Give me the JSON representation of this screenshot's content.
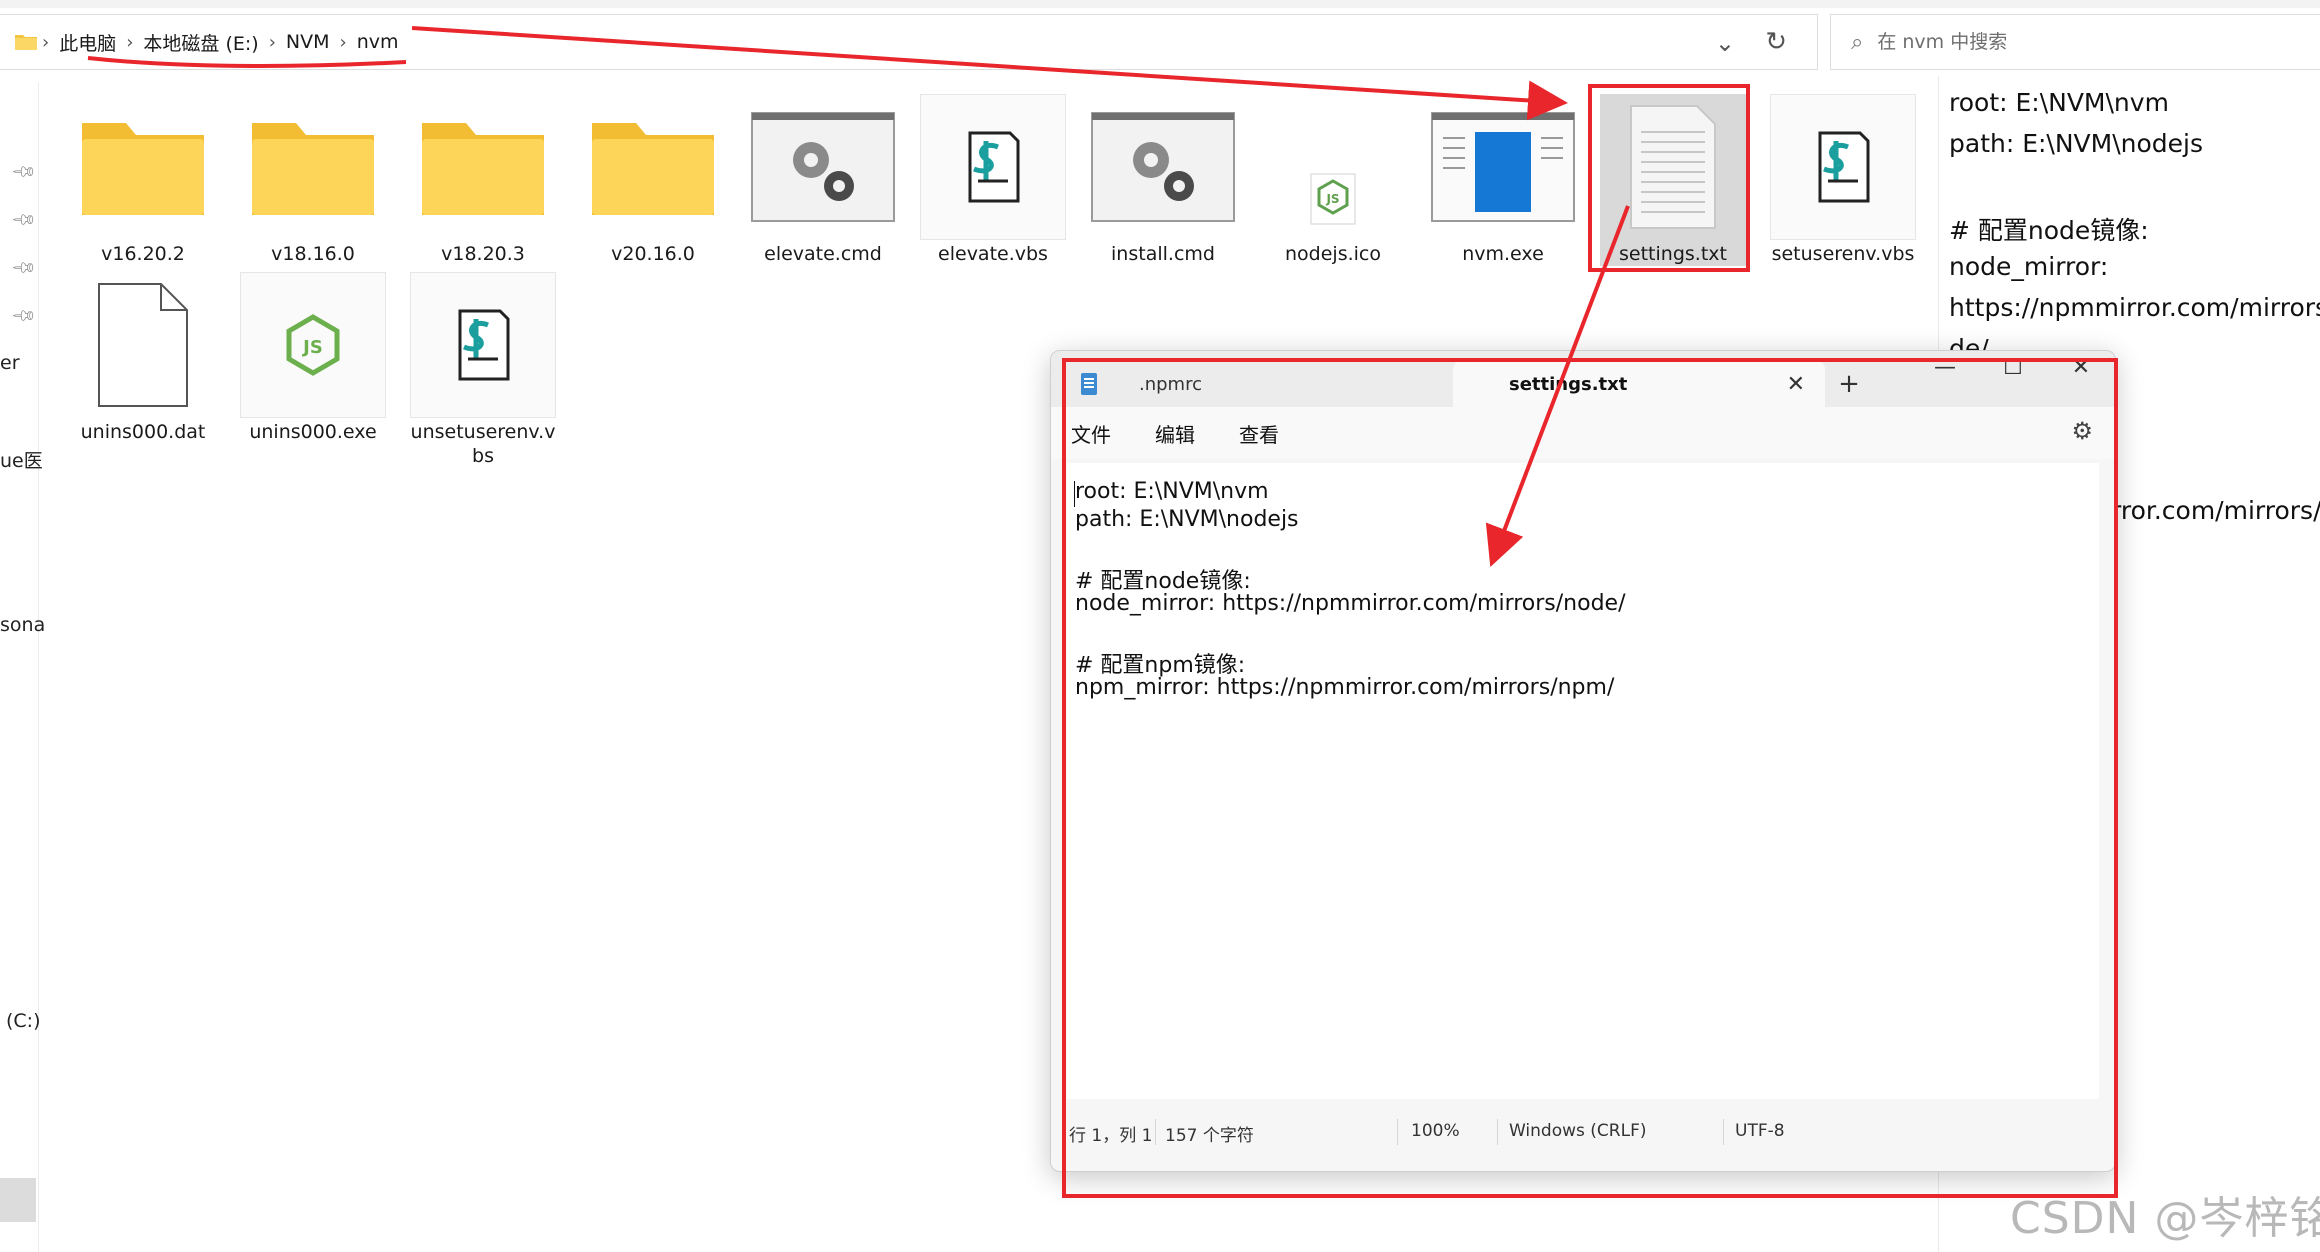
{
  "explorer": {
    "breadcrumbs": [
      "此电脑",
      "本地磁盘 (E:)",
      "NVM",
      "nvm"
    ],
    "search_placeholder": "在 nvm 中搜索",
    "nav_labels": [
      "er",
      "ue医",
      "sona",
      "(C:)"
    ],
    "files_row1": [
      {
        "name": "v16.20.2",
        "icon": "folder-icon"
      },
      {
        "name": "v18.16.0",
        "icon": "folder-icon"
      },
      {
        "name": "v18.20.3",
        "icon": "folder-icon"
      },
      {
        "name": "v20.16.0",
        "icon": "folder-icon"
      },
      {
        "name": "elevate.cmd",
        "icon": "cmd-gear-icon"
      },
      {
        "name": "elevate.vbs",
        "icon": "vbs-script-icon"
      },
      {
        "name": "install.cmd",
        "icon": "cmd-gear-icon"
      },
      {
        "name": "nodejs.ico",
        "icon": "nodejs-icon"
      },
      {
        "name": "nvm.exe",
        "icon": "exe-window-icon"
      },
      {
        "name": "settings.txt",
        "icon": "text-file-icon"
      },
      {
        "name": "setuserenv.vbs",
        "icon": "vbs-script-icon"
      }
    ],
    "files_row2": [
      {
        "name": "unins000.dat",
        "icon": "blank-file-icon"
      },
      {
        "name": "unins000.exe",
        "icon": "nodejs-icon"
      },
      {
        "name": "unsetuserenv.vbs",
        "icon": "vbs-script-icon"
      }
    ],
    "selected_file": "settings.txt"
  },
  "preview": {
    "lines": [
      "root: E:\\NVM\\nvm",
      "path: E:\\NVM\\nodejs",
      "# 配置node镜像:",
      "node_mirror:",
      "https://npmmirror.com/mirrors/n",
      "de/",
      ":",
      "rror.com/mirrors/n"
    ]
  },
  "notepad": {
    "tabs": [
      ".npmrc",
      "settings.txt"
    ],
    "menu": [
      "文件",
      "编辑",
      "查看"
    ],
    "content_lines": [
      "root: E:\\NVM\\nvm",
      "path: E:\\NVM\\nodejs",
      "",
      "# 配置node镜像:",
      "node_mirror: https://npmmirror.com/mirrors/node/",
      "",
      "# 配置npm镜像:",
      "npm_mirror: https://npmmirror.com/mirrors/npm/"
    ],
    "status": {
      "position": "行 1，列 1",
      "char_count": "157 个字符",
      "zoom": "100%",
      "line_ending": "Windows (CRLF)",
      "encoding": "UTF-8"
    }
  },
  "annotation_color": "#e8262c",
  "watermark": "CSDN @岑梓铭"
}
